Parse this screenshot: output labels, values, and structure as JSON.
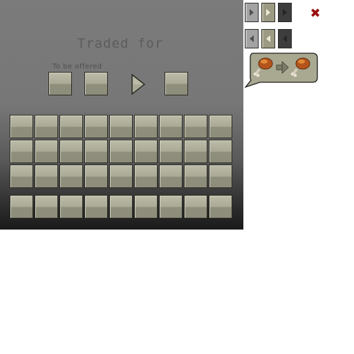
{
  "trade_panel": {
    "title": "Traded for",
    "offer_label": "To be offered"
  },
  "inventory": {
    "rows": 3,
    "columns": 9,
    "hotbar_columns": 9
  },
  "controls": {
    "next_buttons": [
      "next-light",
      "next-highlighted",
      "next-disabled"
    ],
    "prev_buttons": [
      "prev-light",
      "prev-highlighted",
      "prev-disabled"
    ],
    "close_icon": "close-icon"
  },
  "trade_preview": {
    "input_item_icon": "cooked-chicken-icon",
    "arrow_icon": "arrow-right-icon",
    "output_item_icon": "cooked-chicken-icon"
  },
  "colors": {
    "close": "#9a1010",
    "slot": "#aaa996",
    "bubble": "#a9a891"
  }
}
